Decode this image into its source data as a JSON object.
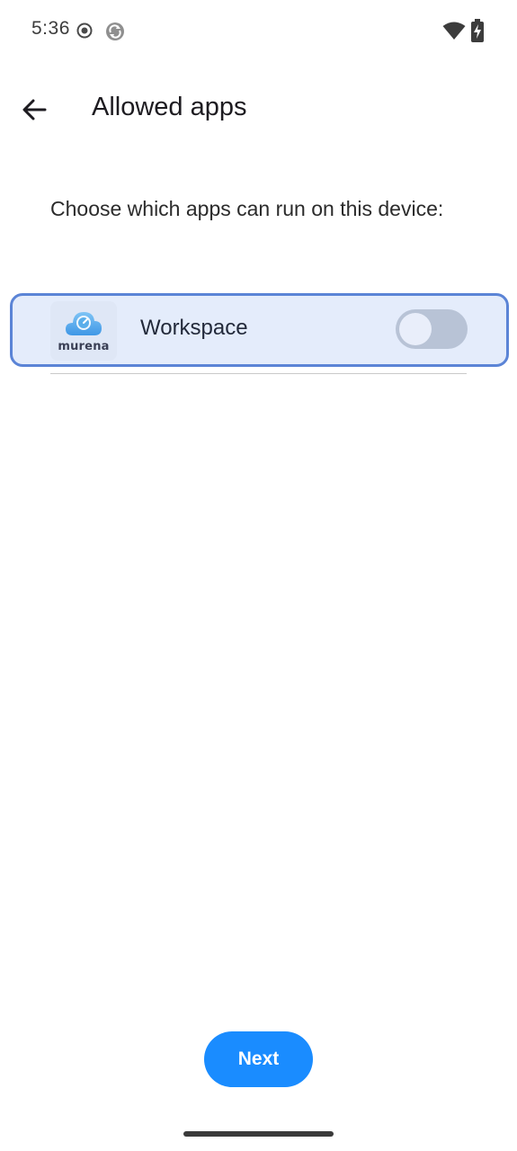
{
  "status_bar": {
    "time": "5:36",
    "icons": [
      "record-icon",
      "sync-icon",
      "wifi-icon",
      "battery-icon"
    ]
  },
  "app_bar": {
    "back_icon": "arrow-left-icon",
    "title": "Allowed apps"
  },
  "description": "Choose which apps can run on this device:",
  "apps": [
    {
      "name": "Workspace",
      "logo_text": "murena",
      "enabled": false
    }
  ],
  "actions": {
    "next_label": "Next"
  },
  "colors": {
    "accent": "#1a8cff",
    "row_highlight": "#e4ecfb",
    "row_border": "#5b84d6",
    "toggle_off_track": "#b8c3d6"
  }
}
